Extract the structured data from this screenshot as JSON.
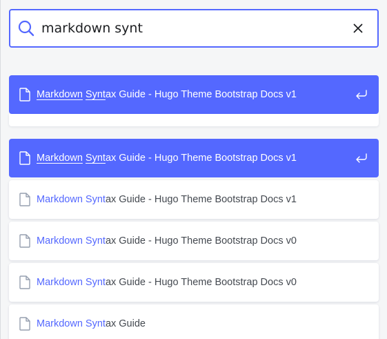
{
  "search": {
    "query": "markdown synt",
    "placeholder": ""
  },
  "colors": {
    "accent": "#5468ff",
    "text": "#444950",
    "background": "#f5f6f7"
  },
  "icons": {
    "search": "search-icon",
    "clear": "close-icon",
    "document": "document-icon",
    "enter": "enter-icon"
  },
  "hits": [
    {
      "hl1": "Markdown",
      "gap": " ",
      "hl2": "Synt",
      "rest": "ax Guide - Hugo Theme Bootstrap Docs v1",
      "selected": true
    },
    {
      "hl1": "Markdown",
      "gap": " ",
      "hl2": "Synt",
      "rest": "ax Guide - Hugo Theme Bootstrap Docs v1",
      "selected": true
    },
    {
      "hl1": "Markdown",
      "gap": " ",
      "hl2": "Synt",
      "rest": "ax Guide - Hugo Theme Bootstrap Docs v1",
      "selected": false
    },
    {
      "hl1": "Markdown",
      "gap": " ",
      "hl2": "Synt",
      "rest": "ax Guide - Hugo Theme Bootstrap Docs v0",
      "selected": false
    },
    {
      "hl1": "Markdown",
      "gap": " ",
      "hl2": "Synt",
      "rest": "ax Guide - Hugo Theme Bootstrap Docs v0",
      "selected": false
    },
    {
      "hl1": "Markdown",
      "gap": " ",
      "hl2": "Synt",
      "rest": "ax Guide",
      "selected": false
    }
  ]
}
